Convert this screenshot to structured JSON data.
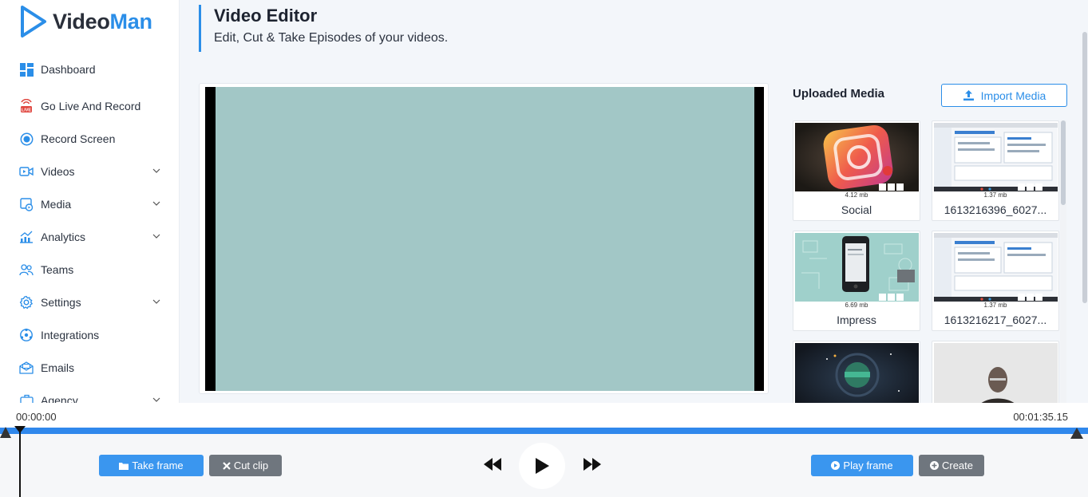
{
  "app": {
    "logo_part1": "Video",
    "logo_part2": "Man",
    "brand_color": "#2b8ee8"
  },
  "sidebar": {
    "items": [
      {
        "label": "Dashboard",
        "icon": "dashboard-grid-icon",
        "has_chevron": false
      },
      {
        "label": "Go Live And Record",
        "icon": "live-icon",
        "has_chevron": false
      },
      {
        "label": "Record Screen",
        "icon": "record-icon",
        "has_chevron": false
      },
      {
        "label": "Videos",
        "icon": "video-icon",
        "has_chevron": true
      },
      {
        "label": "Media",
        "icon": "media-icon",
        "has_chevron": true
      },
      {
        "label": "Analytics",
        "icon": "analytics-icon",
        "has_chevron": true
      },
      {
        "label": "Teams",
        "icon": "teams-icon",
        "has_chevron": false
      },
      {
        "label": "Settings",
        "icon": "gear-icon",
        "has_chevron": true
      },
      {
        "label": "Integrations",
        "icon": "integrations-icon",
        "has_chevron": false
      },
      {
        "label": "Emails",
        "icon": "email-icon",
        "has_chevron": false
      },
      {
        "label": "Agency",
        "icon": "agency-icon",
        "has_chevron": true
      }
    ]
  },
  "header": {
    "title": "Video Editor",
    "subtitle": "Edit, Cut & Take Episodes of your videos."
  },
  "media": {
    "title": "Uploaded Media",
    "import_label": "Import Media",
    "items": [
      {
        "size": "4.12 mb",
        "name": "Social",
        "thumb": "social-3d"
      },
      {
        "size": "1.37 mb",
        "name": "1613216396_6027...",
        "thumb": "screen-capture"
      },
      {
        "size": "6.69 mb",
        "name": "Impress",
        "thumb": "phone-mockup"
      },
      {
        "size": "1.37 mb",
        "name": "1613216217_6027...",
        "thumb": "screen-capture"
      },
      {
        "size": "",
        "name": "",
        "thumb": "dark-globe"
      },
      {
        "size": "",
        "name": "",
        "thumb": "person-webcam"
      }
    ]
  },
  "timeline": {
    "start_time": "00:00:00",
    "end_time": "00:01:35.15",
    "progress": 1.0
  },
  "controls": {
    "take_frame": "Take frame",
    "cut_clip": "Cut clip",
    "play_frame": "Play frame",
    "create": "Create"
  },
  "colors": {
    "accent": "#3a96ef",
    "secondary_button": "#6f767e",
    "video_placeholder": "#a2c7c6"
  }
}
